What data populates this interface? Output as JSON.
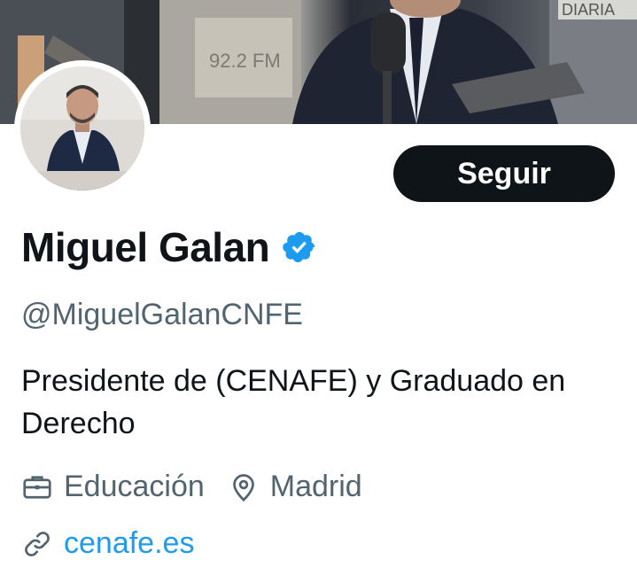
{
  "profile": {
    "name": "Miguel Galan",
    "handle": "@MiguelGalanCNFE",
    "bio": "Presidente de (CENAFE) y Graduado en Derecho",
    "category": "Educación",
    "location": "Madrid",
    "website": "cenafe.es",
    "verified": true
  },
  "banner": {
    "sign_text": "92.2 FM",
    "corner_text": "DIARIA"
  },
  "actions": {
    "follow_label": "Seguir"
  },
  "colors": {
    "accent": "#1d9bf0",
    "text_primary": "#0f1419",
    "text_secondary": "#536471",
    "button_bg": "#0f1419"
  },
  "icons": {
    "verified": "verified-badge-icon",
    "category": "briefcase-icon",
    "location": "location-pin-icon",
    "website": "link-icon"
  }
}
